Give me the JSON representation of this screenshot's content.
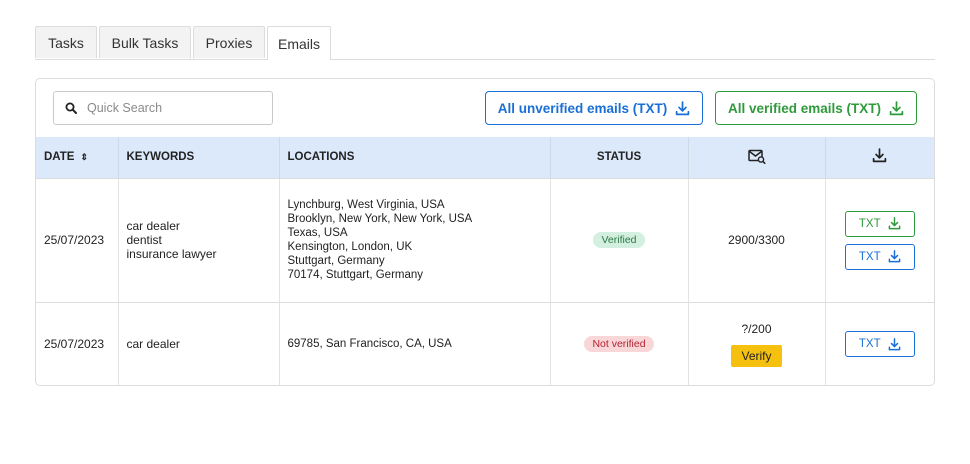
{
  "tabs": [
    {
      "label": "Tasks",
      "active": false
    },
    {
      "label": "Bulk Tasks",
      "active": false
    },
    {
      "label": "Proxies",
      "active": false
    },
    {
      "label": "Emails",
      "active": true
    }
  ],
  "search": {
    "placeholder": "Quick Search"
  },
  "actions": {
    "unverified_label": "All unverified emails (TXT)",
    "verified_label": "All verified emails (TXT)"
  },
  "table": {
    "headers": {
      "date": "DATE",
      "sort_icon": "⇕",
      "keywords": "KEYWORDS",
      "locations": "LOCATIONS",
      "status": "STATUS",
      "emails_icon": "mail-search-icon",
      "download_icon": "download-icon"
    },
    "rows": [
      {
        "date": "25/07/2023",
        "keywords": [
          "car dealer",
          "dentist",
          "insurance lawyer"
        ],
        "locations": [
          "Lynchburg, West Virginia, USA",
          "Brooklyn, New York, New York, USA",
          "Texas, USA",
          "Kensington, London, UK",
          "Stuttgart, Germany",
          "70174, Stuttgart, Germany"
        ],
        "status": "Verified",
        "emails": "2900/3300",
        "txt_verified": "TXT",
        "txt_unverified": "TXT"
      },
      {
        "date": "25/07/2023",
        "keywords": [
          "car dealer"
        ],
        "locations": [
          "69785, San Francisco, CA, USA"
        ],
        "status": "Not verified",
        "emails": "?/200",
        "verify_label": "Verify",
        "txt_unverified": "TXT"
      }
    ]
  },
  "colors": {
    "blue": "#1a6fd6",
    "green": "#2f9a3c",
    "header_bg": "#dce9fb",
    "verify_yellow": "#f5c10e"
  }
}
